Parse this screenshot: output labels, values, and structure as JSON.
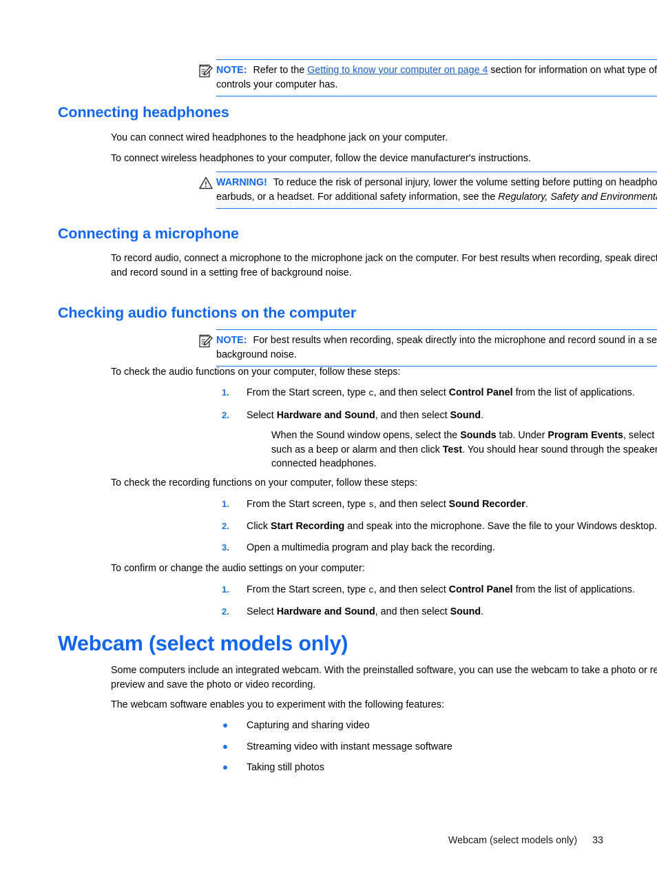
{
  "note_top": {
    "icon": "note-pad-pencil-icon",
    "label": "NOTE:",
    "text_before_link": "Refer to the ",
    "link_text": "Getting to know your computer on page 4",
    "text_after_link": " section for information on what type of volume controls your computer has."
  },
  "headphones": {
    "heading": "Connecting headphones",
    "para1": "You can connect wired headphones to the headphone jack on your computer.",
    "para2": "To connect wireless headphones to your computer, follow the device manufacturer's instructions."
  },
  "warning": {
    "icon": "warning-triangle-icon",
    "label": "WARNING!",
    "text1": "To reduce the risk of personal injury, lower the volume setting before putting on headphones, earbuds, or a headset. For additional safety information, see the ",
    "italic_title": "Regulatory, Safety and Environmental Notices",
    "text2": "."
  },
  "microphone": {
    "heading": "Connecting a microphone",
    "para1": "To record audio, connect a microphone to the microphone jack on the computer. For best results when recording, speak directly into the microphone and record sound in a setting free of background noise."
  },
  "audio_check": {
    "heading": "Checking audio functions on the computer",
    "note": {
      "icon": "note-pad-pencil-icon",
      "label": "NOTE:",
      "text": "For best results when recording, speak directly into the microphone and record sound in a setting free of background noise."
    },
    "intro": "To check the audio functions on your computer, follow these steps:",
    "steps": [
      {
        "num": "1.",
        "parts": [
          {
            "t": "From the Start screen, type ",
            "s": "normal"
          },
          {
            "t": "c",
            "s": "mono"
          },
          {
            "t": ", and then select ",
            "s": "normal"
          },
          {
            "t": "Control Panel",
            "s": "bold"
          },
          {
            "t": " from the list of applications.",
            "s": "normal"
          }
        ]
      },
      {
        "num": "2.",
        "parts": [
          {
            "t": "Select ",
            "s": "normal"
          },
          {
            "t": "Hardware and Sound",
            "s": "bold"
          },
          {
            "t": ", and then select ",
            "s": "normal"
          },
          {
            "t": "Sound",
            "s": "bold"
          },
          {
            "t": ".",
            "s": "normal"
          }
        ]
      }
    ],
    "substep": [
      {
        "t": "When the Sound window opens, select the ",
        "s": "normal"
      },
      {
        "t": "Sounds",
        "s": "bold"
      },
      {
        "t": " tab. Under ",
        "s": "normal"
      },
      {
        "t": "Program Events",
        "s": "bold"
      },
      {
        "t": ", select any sound event, such as a beep or alarm and then click ",
        "s": "normal"
      },
      {
        "t": "Test",
        "s": "bold"
      },
      {
        "t": ". You should hear sound through the speakers or through connected headphones.",
        "s": "normal"
      }
    ],
    "recording_intro": "To check the recording functions on your computer, follow these steps:",
    "recording_steps": [
      {
        "num": "1.",
        "parts": [
          {
            "t": "From the Start screen, type ",
            "s": "normal"
          },
          {
            "t": "s",
            "s": "mono"
          },
          {
            "t": ", and then select ",
            "s": "normal"
          },
          {
            "t": "Sound Recorder",
            "s": "bold"
          },
          {
            "t": ".",
            "s": "normal"
          }
        ]
      },
      {
        "num": "2.",
        "parts": [
          {
            "t": "Click ",
            "s": "normal"
          },
          {
            "t": "Start Recording",
            "s": "bold"
          },
          {
            "t": " and speak into the microphone. Save the file to your Windows desktop.",
            "s": "normal"
          }
        ]
      },
      {
        "num": "3.",
        "parts": [
          {
            "t": "Open a multimedia program and play back the recording.",
            "s": "normal"
          }
        ]
      }
    ],
    "confirm_intro": "To confirm or change the audio settings on your computer:",
    "confirm_steps": [
      {
        "num": "1.",
        "parts": [
          {
            "t": "From the Start screen, type ",
            "s": "normal"
          },
          {
            "t": "c",
            "s": "mono"
          },
          {
            "t": ", and then select ",
            "s": "normal"
          },
          {
            "t": "Control Panel",
            "s": "bold"
          },
          {
            "t": " from the list of applications.",
            "s": "normal"
          }
        ]
      },
      {
        "num": "2.",
        "parts": [
          {
            "t": "Select ",
            "s": "normal"
          },
          {
            "t": "Hardware and Sound",
            "s": "bold"
          },
          {
            "t": ", and then select ",
            "s": "normal"
          },
          {
            "t": "Sound",
            "s": "bold"
          },
          {
            "t": ".",
            "s": "normal"
          }
        ]
      }
    ]
  },
  "webcam": {
    "heading": "Webcam (select models only)",
    "para1": "Some computers include an integrated webcam. With the preinstalled software, you can use the webcam to take a photo or record a video. You can preview and save the photo or video recording.",
    "para2": "The webcam software enables you to experiment with the following features:",
    "bullets": [
      "Capturing and sharing video",
      "Streaming video with instant message software",
      "Taking still photos"
    ]
  },
  "footer": {
    "text": "Webcam (select models only)",
    "page_number": "33"
  },
  "colors": {
    "heading_blue": "#1166ee",
    "rule_blue": "#1a7ae0",
    "link_blue": "#1a5fc8",
    "bullet_blue": "#1a7ae0",
    "body_black": "#000000"
  }
}
